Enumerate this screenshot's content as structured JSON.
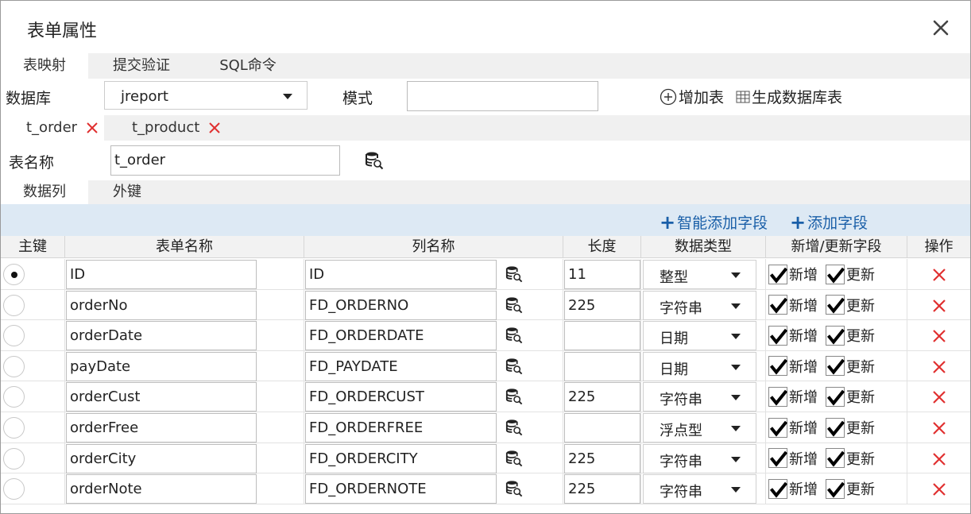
{
  "dialog": {
    "title": "表单属性"
  },
  "top_tabs": [
    "表映射",
    "提交验证",
    "SQL命令"
  ],
  "db": {
    "db_label": "数据库",
    "db_value": "jreport",
    "mode_label": "模式",
    "mode_value": "",
    "add_table": "增加表",
    "gen_table": "生成数据库表"
  },
  "table_tabs": [
    "t_order",
    "t_product"
  ],
  "table_name": {
    "label": "表名称",
    "value": "t_order"
  },
  "sub_tabs": [
    "数据列",
    "外键"
  ],
  "toolbar": {
    "smart_add": "智能添加字段",
    "add": "添加字段"
  },
  "headers": [
    "主键",
    "表单名称",
    "列名称",
    "长度",
    "数据类型",
    "新增/更新字段",
    "操作"
  ],
  "checkbox_labels": {
    "insert": "新增",
    "update": "更新"
  },
  "rows": [
    {
      "form_name": "ID",
      "column": "ID",
      "length": "11",
      "type": "整型",
      "pk": true
    },
    {
      "form_name": "orderNo",
      "column": "FD_ORDERNO",
      "length": "225",
      "type": "字符串",
      "pk": false
    },
    {
      "form_name": "orderDate",
      "column": "FD_ORDERDATE",
      "length": "",
      "type": "日期",
      "pk": false
    },
    {
      "form_name": "payDate",
      "column": "FD_PAYDATE",
      "length": "",
      "type": "日期",
      "pk": false
    },
    {
      "form_name": "orderCust",
      "column": "FD_ORDERCUST",
      "length": "225",
      "type": "字符串",
      "pk": false
    },
    {
      "form_name": "orderFree",
      "column": "FD_ORDERFREE",
      "length": "",
      "type": "浮点型",
      "pk": false
    },
    {
      "form_name": "orderCity",
      "column": "FD_ORDERCITY",
      "length": "225",
      "type": "字符串",
      "pk": false
    },
    {
      "form_name": "orderNote",
      "column": "FD_ORDERNOTE",
      "length": "225",
      "type": "字符串",
      "pk": false
    }
  ],
  "colors": {
    "toolbar_bg": "#dde9f4",
    "link": "#1a5fa8",
    "delete": "#e03030"
  }
}
